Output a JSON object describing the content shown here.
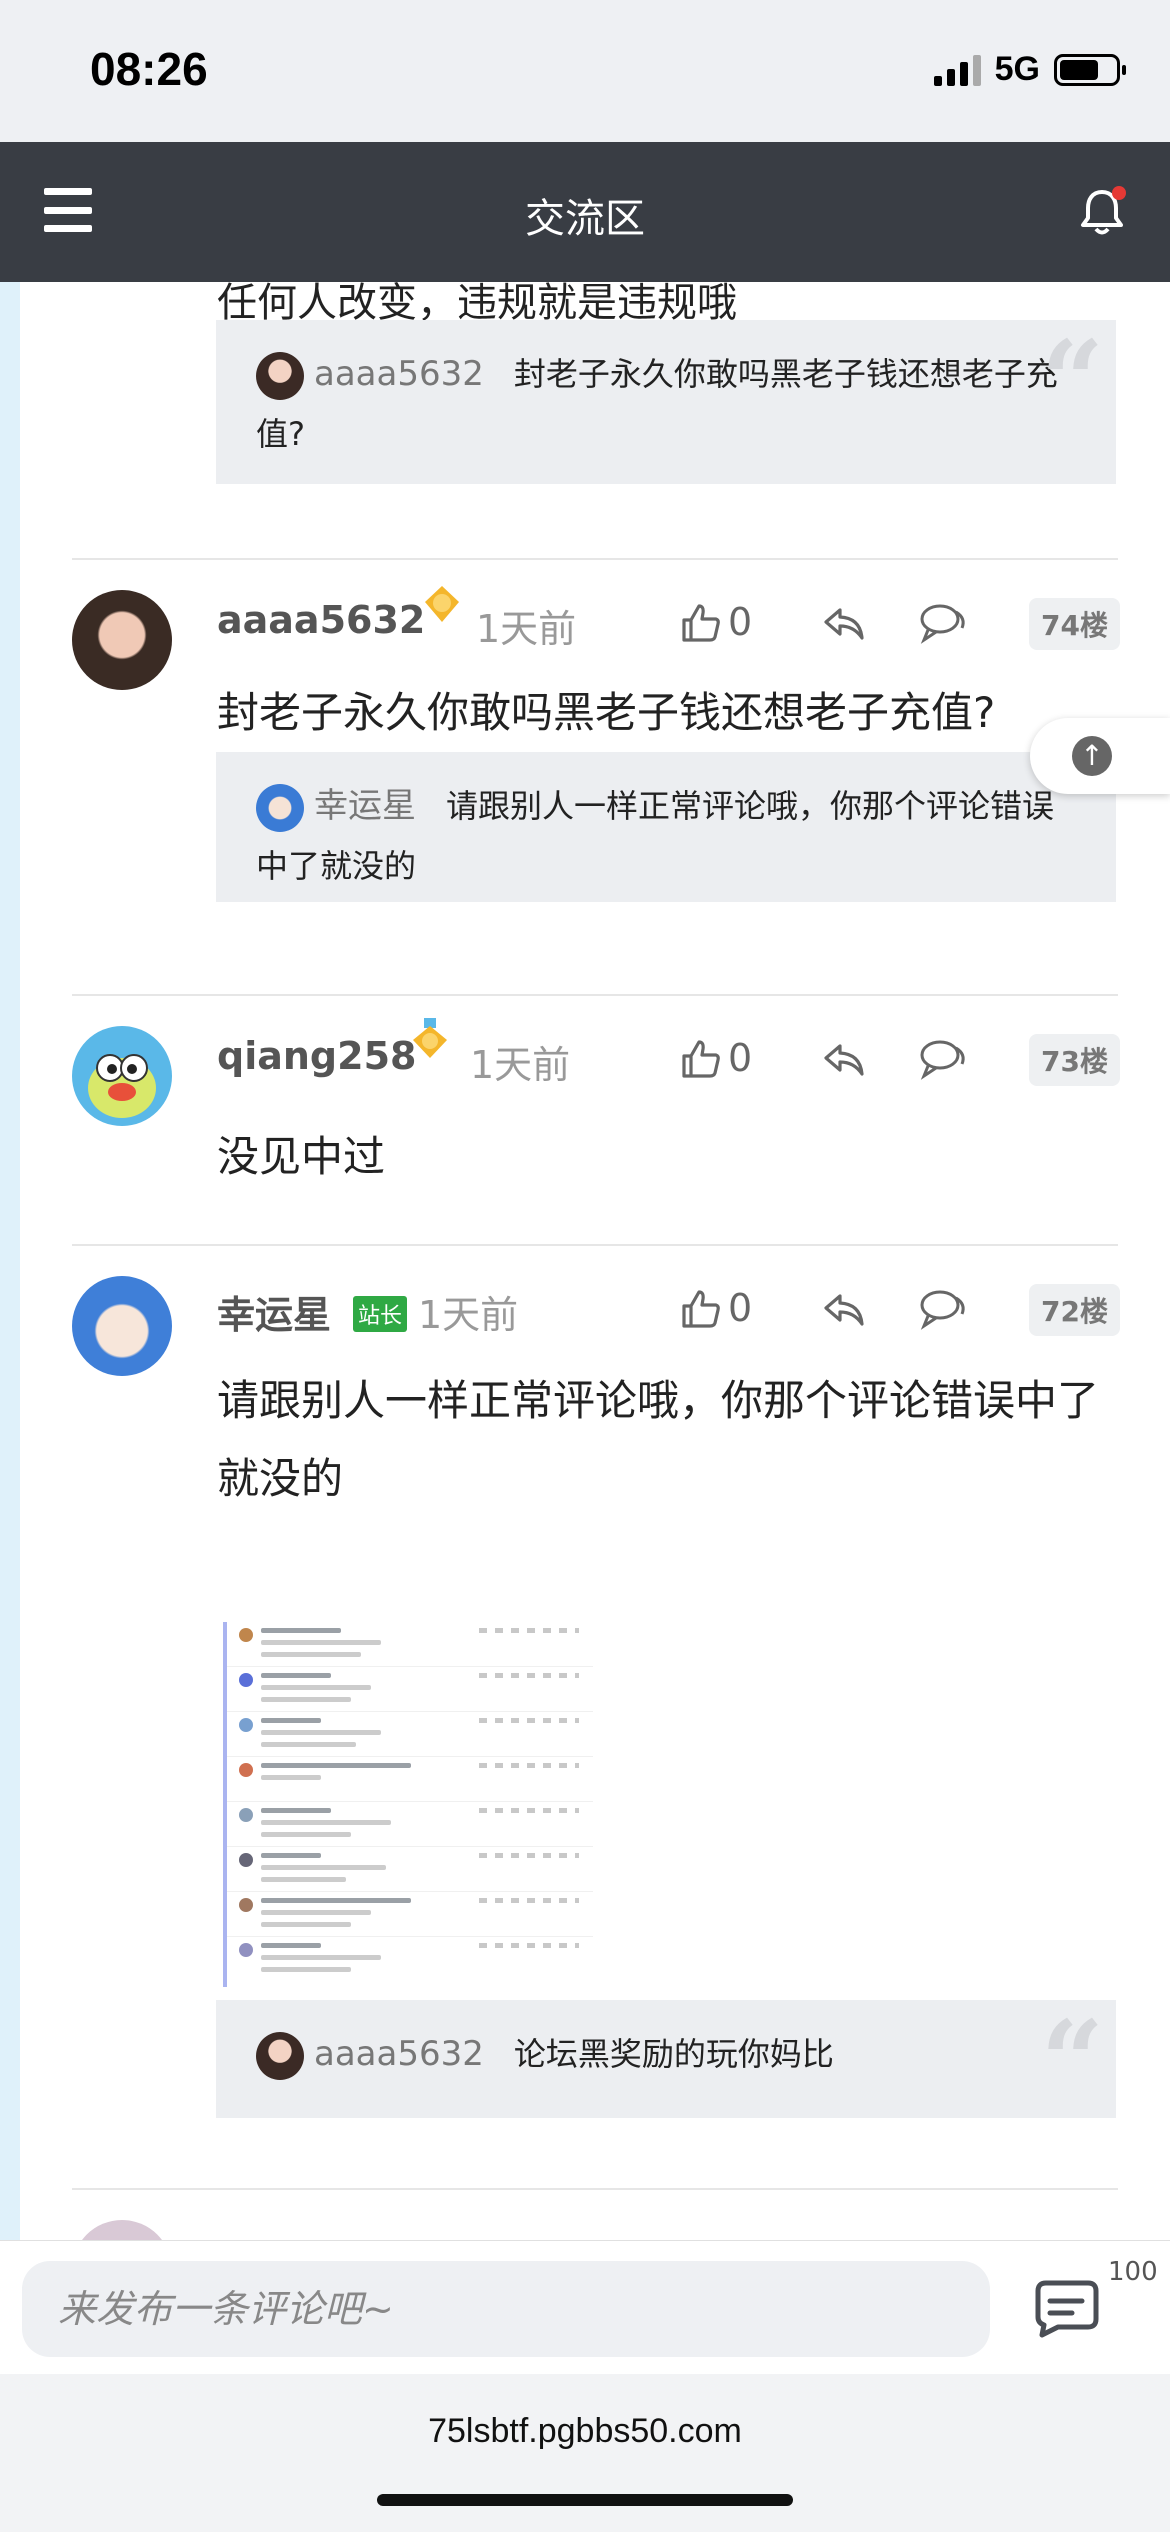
{
  "status_bar": {
    "time": "08:26",
    "network": "5G"
  },
  "header": {
    "title": "交流区"
  },
  "top_partial": {
    "text": "任何人改变，违规就是违规哦",
    "quote": {
      "user": "aaaa5632",
      "text": "封老子永久你敢吗黑老子钱还想老子充值?"
    }
  },
  "posts": [
    {
      "user": "aaaa5632",
      "level": "4",
      "time": "1天前",
      "likes": "0",
      "floor": "74楼",
      "text": "封老子永久你敢吗黑老子钱还想老子充值?",
      "quote": {
        "user": "幸运星",
        "text": "请跟别人一样正常评论哦，你那个评论错误中了就没的"
      }
    },
    {
      "user": "qiang258",
      "level": "1",
      "time": "1天前",
      "likes": "0",
      "floor": "73楼",
      "text": "没见中过"
    },
    {
      "user": "幸运星",
      "badge": "站长",
      "time": "1天前",
      "likes": "0",
      "floor": "72楼",
      "text": "请跟别人一样正常评论哦，你那个评论错误中了就没的",
      "quote": {
        "user": "aaaa5632",
        "text": "论坛黑奖励的玩你妈比"
      }
    }
  ],
  "input": {
    "placeholder": "来发布一条评论吧~",
    "count": "100"
  },
  "url": "75lsbtf.pgbbs50.com",
  "colors": {
    "header_bg": "#393d44",
    "admin_badge": "#2fa944",
    "notification_dot": "#e53935",
    "quote_bg": "#eceef1"
  }
}
